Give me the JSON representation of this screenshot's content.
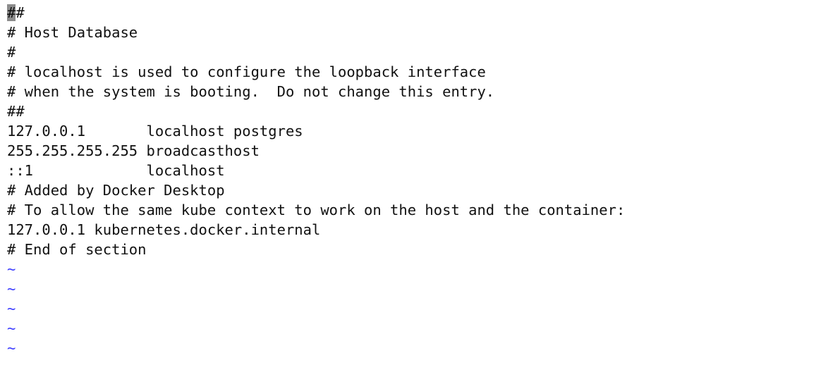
{
  "editor": {
    "cursor_char": "#",
    "lines": [
      "#",
      "# Host Database",
      "#",
      "# localhost is used to configure the loopback interface",
      "# when the system is booting.  Do not change this entry.",
      "##",
      "127.0.0.1       localhost postgres",
      "255.255.255.255 broadcasthost",
      "::1             localhost",
      "# Added by Docker Desktop",
      "# To allow the same kube context to work on the host and the container:",
      "127.0.0.1 kubernetes.docker.internal",
      "# End of section"
    ],
    "tilde": "~",
    "tilde_color": "#3b3bff",
    "cursor_color": "#8c8c8c"
  }
}
